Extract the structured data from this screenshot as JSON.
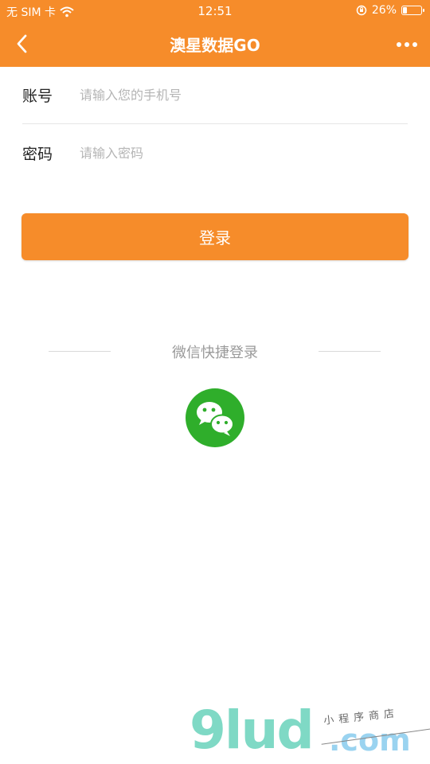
{
  "status_bar": {
    "carrier": "无 SIM 卡",
    "time": "12:51",
    "battery_percent": "26%",
    "battery_level": 0.26,
    "icons": [
      "wifi-icon",
      "orientation-lock-icon",
      "battery-icon"
    ]
  },
  "nav": {
    "title": "澳星数据GO",
    "back_icon": "chevron-left-icon",
    "more_icon": "more-dots-icon"
  },
  "form": {
    "account_label": "账号",
    "account_placeholder": "请输入您的手机号",
    "account_value": "",
    "password_label": "密码",
    "password_placeholder": "请输入密码",
    "password_value": ""
  },
  "login_button_label": "登录",
  "quick_login": {
    "label": "微信快捷登录",
    "icon": "wechat-icon"
  },
  "watermark": {
    "main": "9lud",
    "domain": ".com",
    "subtitle": "小程序商店"
  },
  "colors": {
    "accent": "#f68c2a",
    "wechat": "#2fae2b",
    "watermark": "#7fd9c5"
  }
}
